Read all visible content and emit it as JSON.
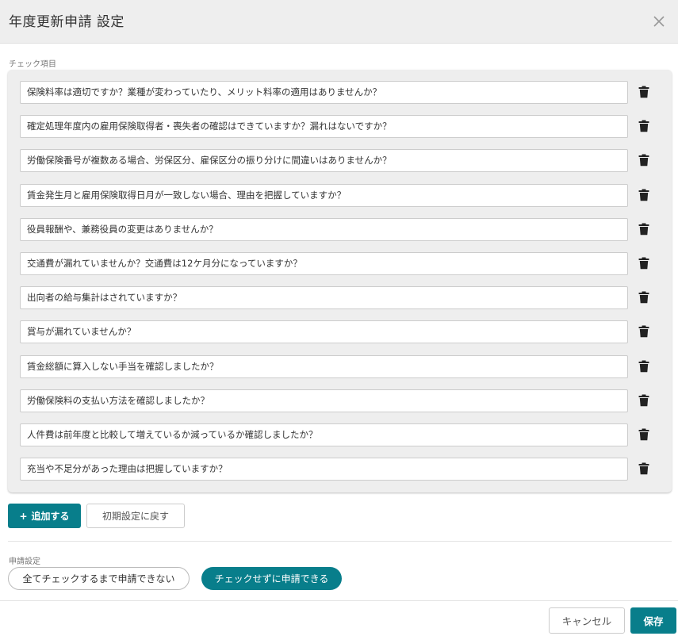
{
  "dialog": {
    "title": "年度更新申請 設定",
    "close_icon": "close-icon"
  },
  "checklist": {
    "label": "チェック項目",
    "items": [
      {
        "value": "保険料率は適切ですか？業種が変わっていたり、メリット料率の適用はありませんか？"
      },
      {
        "value": "確定処理年度内の雇用保険取得者・喪失者の確認はできていますか？漏れはないですか？"
      },
      {
        "value": "労働保険番号が複数ある場合、労保区分、雇保区分の振り分けに間違いはありませんか？"
      },
      {
        "value": "賃金発生月と雇用保険取得日月が一致しない場合、理由を把握していますか？"
      },
      {
        "value": "役員報酬や、兼務役員の変更はありませんか？"
      },
      {
        "value": "交通費が漏れていませんか？交通費は12ケ月分になっていますか？"
      },
      {
        "value": "出向者の給与集計はされていますか？"
      },
      {
        "value": "賞与が漏れていませんか？"
      },
      {
        "value": "賃金総額に算入しない手当を確認しましたか？"
      },
      {
        "value": "労働保険料の支払い方法を確認しましたか？"
      },
      {
        "value": "人件費は前年度と比較して増えているか減っているか確認しましたか？"
      },
      {
        "value": "充当や不足分があった理由は把握していますか？"
      }
    ],
    "delete_icon": "trash-icon"
  },
  "actions": {
    "add_icon": "+",
    "add_label": "追加する",
    "reset_label": "初期設定に戻す"
  },
  "application_setting": {
    "label": "申請設定",
    "options": [
      {
        "label": "全てチェックするまで申請できない",
        "selected": false
      },
      {
        "label": "チェックせずに申請できる",
        "selected": true
      }
    ]
  },
  "footer": {
    "cancel_label": "キャンセル",
    "save_label": "保存"
  },
  "colors": {
    "accent": "#087e8b",
    "header_bg": "#eeeeee",
    "panel_bg": "#eeeeee"
  }
}
